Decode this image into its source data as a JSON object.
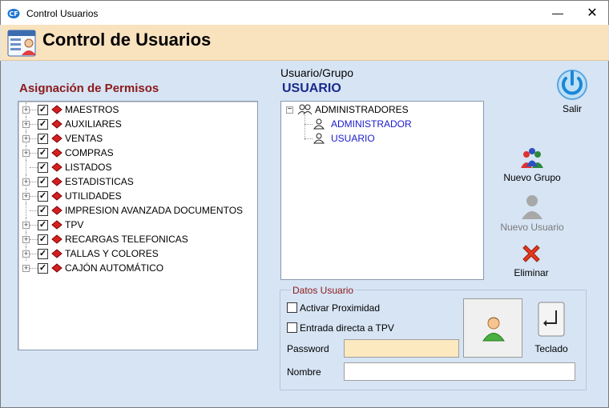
{
  "window": {
    "title": "Control Usuarios",
    "minimize_glyph": "—",
    "close_glyph": "✕"
  },
  "header": {
    "title": "Control de Usuarios",
    "icon": "user-list-icon"
  },
  "permissions": {
    "label": "Asignación de Permisos",
    "items": [
      {
        "label": "MAESTROS",
        "checked": true,
        "expandable": true
      },
      {
        "label": "AUXILIARES",
        "checked": true,
        "expandable": true
      },
      {
        "label": "VENTAS",
        "checked": true,
        "expandable": true
      },
      {
        "label": "COMPRAS",
        "checked": true,
        "expandable": true
      },
      {
        "label": "LISTADOS",
        "checked": true,
        "expandable": false
      },
      {
        "label": "ESTADISTICAS",
        "checked": true,
        "expandable": true
      },
      {
        "label": "UTILIDADES",
        "checked": true,
        "expandable": true
      },
      {
        "label": "IMPRESION AVANZADA DOCUMENTOS",
        "checked": true,
        "expandable": false
      },
      {
        "label": "TPV",
        "checked": true,
        "expandable": true
      },
      {
        "label": "RECARGAS TELEFONICAS",
        "checked": true,
        "expandable": true
      },
      {
        "label": "TALLAS Y COLORES",
        "checked": true,
        "expandable": true
      },
      {
        "label": "CAJÓN  AUTOMÁTICO",
        "checked": true,
        "expandable": true
      }
    ],
    "check_glyph": "✓"
  },
  "user_group": {
    "caption": "Usuario/Grupo",
    "selected": "USUARIO",
    "tree": {
      "group": "ADMINISTRADORES",
      "collapse_glyph": "−",
      "users": [
        "ADMINISTRADOR",
        "USUARIO"
      ]
    },
    "user_color": "#1a1acc"
  },
  "actions": {
    "salir": "Salir",
    "nuevo_grupo": "Nuevo Grupo",
    "nuevo_usuario": "Nuevo Usuario",
    "eliminar": "Eliminar"
  },
  "datos_usuario": {
    "legend": "Datos Usuario",
    "activar_proximidad": "Activar Proximidad",
    "entrada_directa": "Entrada directa a TPV",
    "password_label": "Password",
    "password_value": "",
    "nombre_label": "Nombre",
    "nombre_value": "",
    "teclado": "Teclado"
  },
  "colors": {
    "header_bg": "#f9e2be",
    "body_bg": "#d6e4f4",
    "accent_red": "#8b1a1a",
    "accent_blue": "#1a2a8a"
  }
}
